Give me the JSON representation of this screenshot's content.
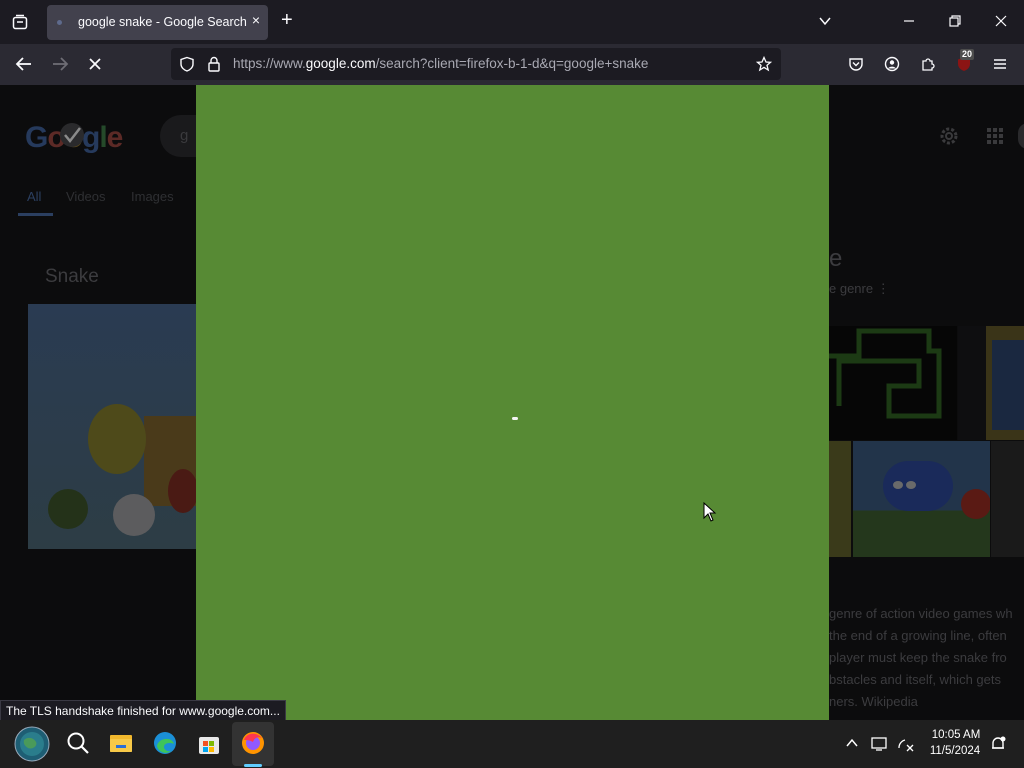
{
  "browser": {
    "tab": {
      "title": "google snake - Google Search",
      "close": "×"
    },
    "new_tab": "+",
    "url": {
      "scheme": "https://www.",
      "host": "google.com",
      "rest": "/search?client=firefox-b-1-d&q=google+snake"
    },
    "extensions_badge": "20",
    "status_text": "The TLS handshake finished for www.google.com..."
  },
  "page": {
    "logo": [
      "G",
      "o",
      "o",
      "g",
      "l",
      "e"
    ],
    "search_prefix": "g",
    "tabs": [
      "All",
      "Videos",
      "Images"
    ],
    "left_title": "Snake",
    "right_title": "e",
    "right_subtitle": "e genre ⋮",
    "description_lines": [
      "genre of action video games wh",
      "the end of a growing line, often",
      "player must keep the snake fro",
      "bstacles and itself, which gets",
      "ners. Wikipedia"
    ]
  },
  "game": {
    "background_color": "#578a34",
    "snake_color": "#f4f4f4"
  },
  "taskbar": {
    "time": "10:05 AM",
    "date": "11/5/2024"
  }
}
